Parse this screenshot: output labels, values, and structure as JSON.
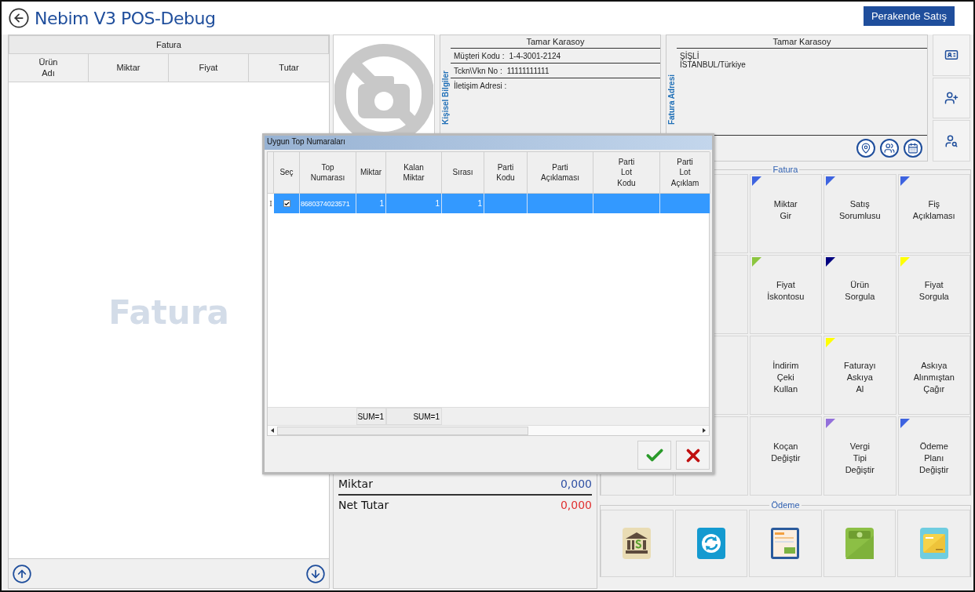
{
  "header": {
    "title": "Nebim V3 POS-Debug",
    "mode_button": "Perakende Satış"
  },
  "invoice_table": {
    "title": "Fatura",
    "columns": [
      "Ürün\nAdı",
      "Miktar",
      "Fiyat",
      "Tutar"
    ],
    "watermark": "Fatura"
  },
  "customer": {
    "section_label": "Kişisel Bilgiler",
    "name": "Tamar Karasoy",
    "fields": [
      {
        "label": "Müşteri Kodu :",
        "value": "1-4-3001-2124"
      },
      {
        "label": "Tckn\\Vkn No :",
        "value": "11111111111"
      },
      {
        "label": "İletişim Adresi :"
      }
    ]
  },
  "billing_address": {
    "section_label": "Fatura Adresi",
    "name": "Tamar Karasoy",
    "lines": [
      "ŞİŞLİ",
      "İSTANBUL/Türkiye"
    ]
  },
  "totals": [
    {
      "label": "Miktar",
      "value": "0,000",
      "color": "#2e4fa3"
    },
    {
      "label": "Net Tutar",
      "value": "0,000",
      "color": "#e03030"
    }
  ],
  "fatura_group": {
    "title": "Fatura",
    "buttons": [
      {
        "label": "Miktar\nGir",
        "color": "#3d63e0"
      },
      {
        "label": "Satış\nSorumlusu",
        "color": "#3d63e0"
      },
      {
        "label": "Fiş\nAçıklaması",
        "color": "#3d63e0"
      },
      {
        "label": "Fiyat\nİskontosu",
        "color": "#8cc63f"
      },
      {
        "label": "Ürün\nSorgula",
        "color": "#000080"
      },
      {
        "label": "Fiyat\nSorgula",
        "color": "#ffff00"
      },
      {
        "label": "İndirim\nÇeki\nKullan"
      },
      {
        "label": "Faturayı\nAskıya\nAl",
        "color": "#ffff00"
      },
      {
        "label": "Askıya\nAlınmıştan\nÇağır"
      },
      {
        "label": "Koçan\nDeğiştir"
      },
      {
        "label": "Vergi\nTipi\nDeğiştir",
        "color": "#9370db"
      },
      {
        "label": "Ödeme\nPlanı\nDeğiştir",
        "color": "#3d63e0"
      }
    ]
  },
  "payment_group": {
    "title": "Ödeme",
    "buttons": [
      {
        "kind": "bank"
      },
      {
        "kind": "exchange"
      },
      {
        "kind": "notes"
      },
      {
        "kind": "cash"
      },
      {
        "kind": "voucher"
      }
    ]
  },
  "dialog": {
    "title": "Uygun Top Numaraları",
    "columns": [
      {
        "label": "Seç"
      },
      {
        "label": "Top\nNumarası"
      },
      {
        "label": "Miktar",
        "summary": "SUM=1"
      },
      {
        "label": "Kalan\nMiktar",
        "summary": "SUM=1"
      },
      {
        "label": "Sırası"
      },
      {
        "label": "Parti\nKodu"
      },
      {
        "label": "Parti\nAçıklaması"
      },
      {
        "label": "Parti\nLot\nKodu"
      },
      {
        "label": "Parti\nLot\nAçıklam"
      }
    ],
    "rows": [
      {
        "selected": true,
        "checked": true,
        "indicator": "I",
        "top_number": "8680374023571",
        "quantity": "1",
        "remaining": "1",
        "order": "1"
      }
    ]
  }
}
